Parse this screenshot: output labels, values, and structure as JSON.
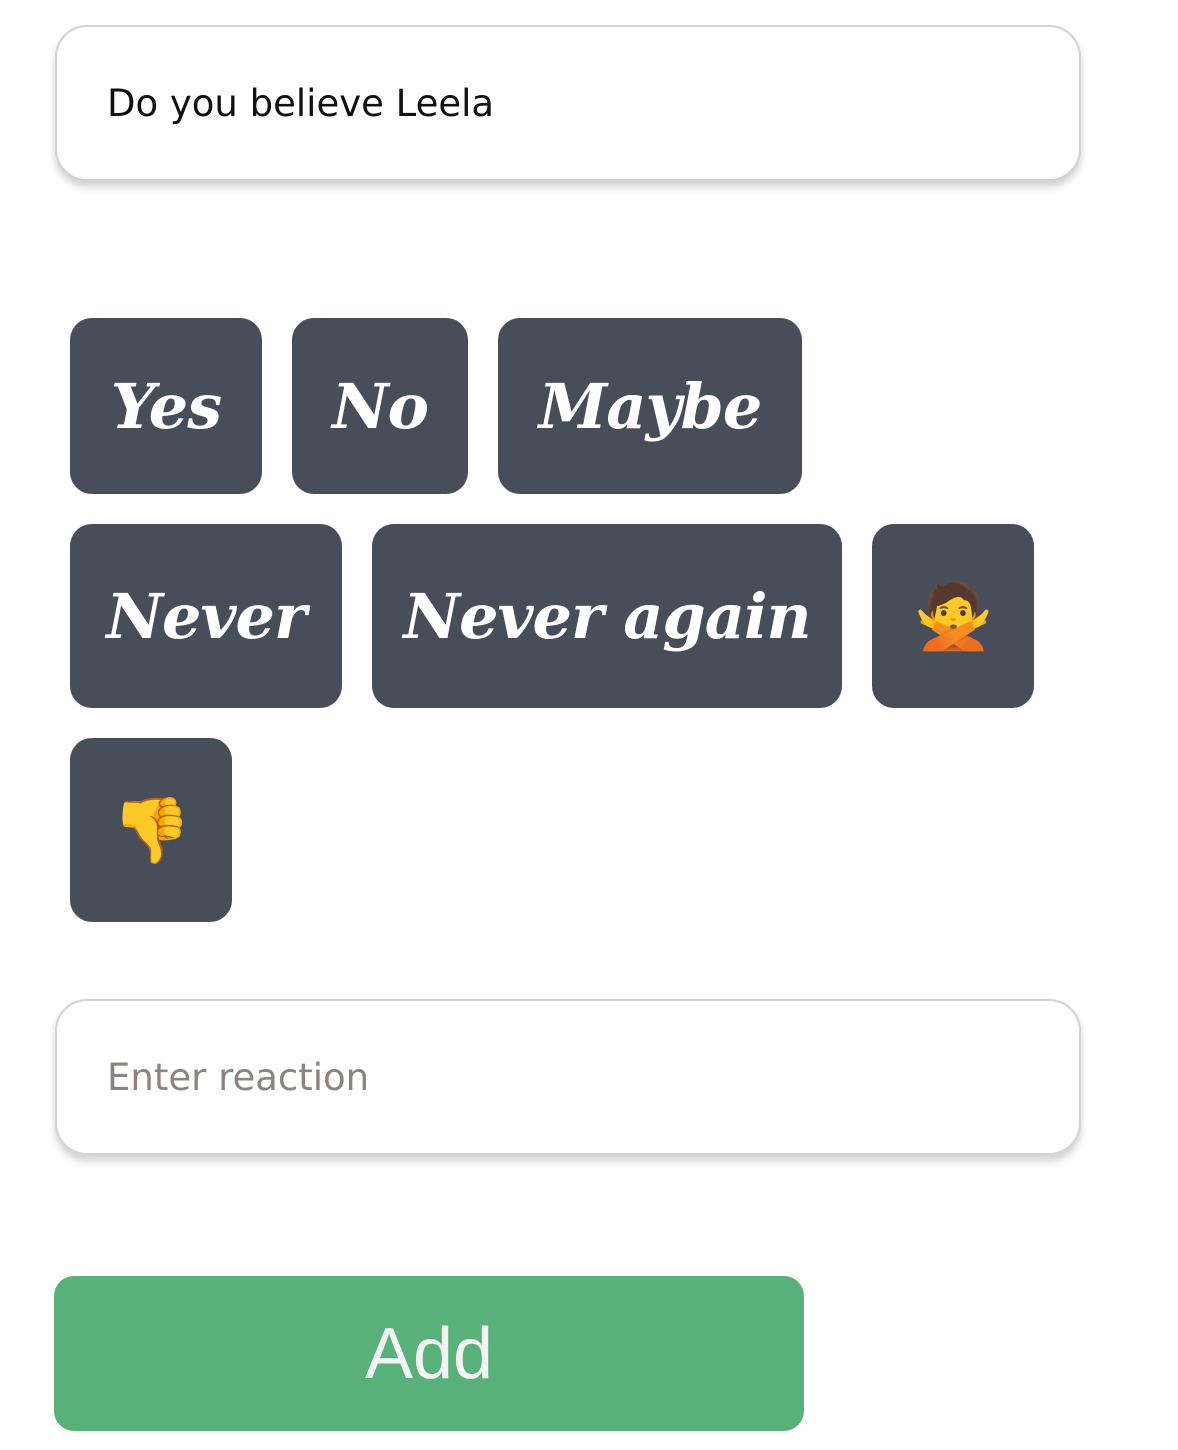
{
  "question": {
    "value": "Do you believe Leela"
  },
  "reactions": [
    {
      "label": "Yes"
    },
    {
      "label": "No"
    },
    {
      "label": "Maybe"
    },
    {
      "label": "Never"
    },
    {
      "label": "Never again"
    },
    {
      "label": "🙅",
      "icon": "person-gesturing-no-icon"
    },
    {
      "label": "👎",
      "icon": "thumbs-down-icon"
    }
  ],
  "reaction_input": {
    "placeholder": "Enter reaction"
  },
  "add_button": {
    "label": "Add"
  },
  "colors": {
    "reaction_button_bg": "#474e59",
    "add_button_bg": "#58b178"
  }
}
